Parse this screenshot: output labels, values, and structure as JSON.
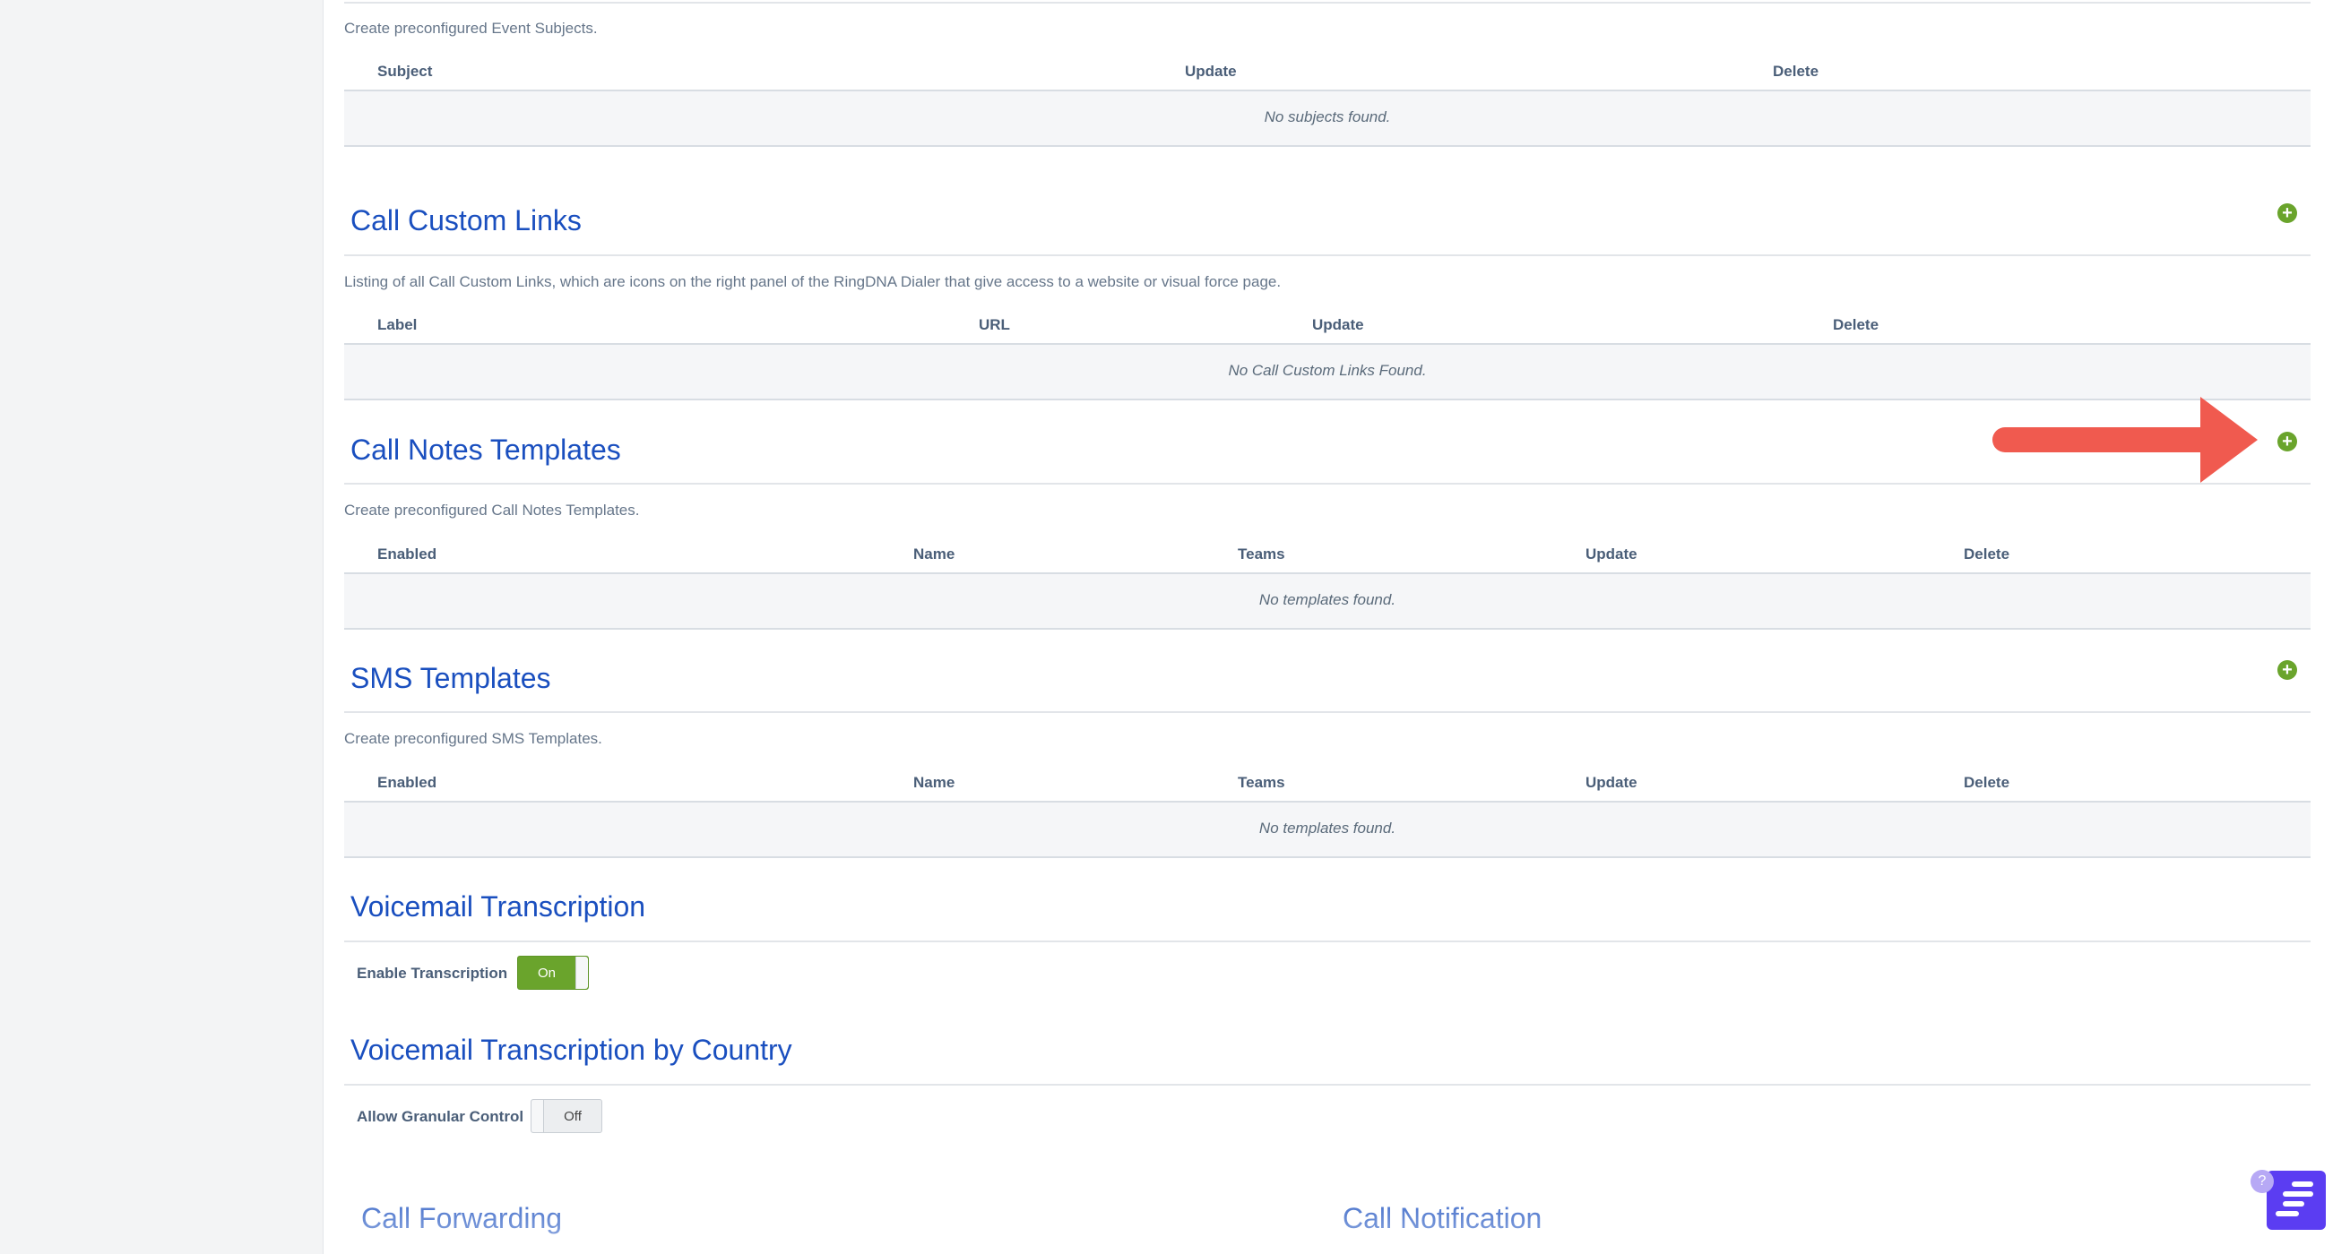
{
  "event_subjects": {
    "description": "Create preconfigured Event Subjects.",
    "columns": [
      "Subject",
      "Update",
      "Delete"
    ],
    "empty_text": "No subjects found."
  },
  "call_custom_links": {
    "title": "Call Custom Links",
    "description": "Listing of all Call Custom Links, which are icons on the right panel of the RingDNA Dialer that give access to a website or visual force page.",
    "columns": [
      "Label",
      "URL",
      "Update",
      "Delete"
    ],
    "empty_text": "No Call Custom Links Found."
  },
  "call_notes_templates": {
    "title": "Call Notes Templates",
    "description": "Create preconfigured Call Notes Templates.",
    "columns": [
      "Enabled",
      "Name",
      "Teams",
      "Update",
      "Delete"
    ],
    "empty_text": "No templates found."
  },
  "sms_templates": {
    "title": "SMS Templates",
    "description": "Create preconfigured SMS Templates.",
    "columns": [
      "Enabled",
      "Name",
      "Teams",
      "Update",
      "Delete"
    ],
    "empty_text": "No templates found."
  },
  "voicemail_transcription": {
    "title": "Voicemail Transcription",
    "field_label": "Enable Transcription",
    "toggle_state": "On"
  },
  "voicemail_transcription_by_country": {
    "title": "Voicemail Transcription by Country",
    "field_label": "Allow Granular Control",
    "toggle_state": "Off"
  },
  "bottom_sections": {
    "call_forwarding_title": "Call Forwarding",
    "call_notification_title": "Call Notification"
  },
  "icons": {
    "add": "plus-circle-icon",
    "annotation": "red-arrow-icon",
    "help": "help-chat-icon"
  },
  "colors": {
    "title_blue": "#1a4fbf",
    "add_green": "#6aa42c",
    "arrow_red": "#f05a4f",
    "help_purple": "#5b3df2"
  },
  "help": {
    "badge": "?"
  }
}
